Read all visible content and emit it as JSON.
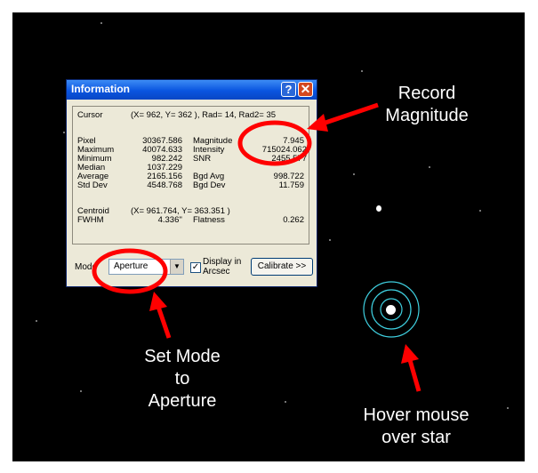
{
  "window": {
    "title": "Information",
    "help_glyph": "?",
    "close_glyph": "✕",
    "cursor_label": "Cursor",
    "cursor_value": "(X= 962, Y= 362 ), Rad= 14, Rad2= 35",
    "pixel_label": "Pixel",
    "pixel_value": "30367.586",
    "maximum_label": "Maximum",
    "maximum_value": "40074.633",
    "minimum_label": "Minimum",
    "minimum_value": "982.242",
    "median_label": "Median",
    "median_value": "1037.229",
    "average_label": "Average",
    "average_value": "2165.156",
    "stddev_label": "Std Dev",
    "stddev_value": "4548.768",
    "magnitude_label": "Magnitude",
    "magnitude_value": "7.945",
    "intensity_label": "Intensity",
    "intensity_value": "715024.062",
    "snr_label": "SNR",
    "snr_value": "2455.577",
    "bgdavg_label": "Bgd Avg",
    "bgdavg_value": "998.722",
    "bgddev_label": "Bgd Dev",
    "bgddev_value": "11.759",
    "centroid_label": "Centroid",
    "centroid_value": "(X= 961.764, Y= 363.351 )",
    "fwhm_label": "FWHM",
    "fwhm_value": "4.336''",
    "flatness_label": "Flatness",
    "flatness_value": "0.262",
    "mode_label": "Mode",
    "mode_value": "Aperture",
    "display_arcsec_checked": true,
    "display_arcsec_label_1": "Display in",
    "display_arcsec_label_2": "Arcsec",
    "calibrate_label": "Calibrate >>"
  },
  "annotations": {
    "record_line1": "Record",
    "record_line2": "Magnitude",
    "setmode_line1": "Set Mode",
    "setmode_line2": "to",
    "setmode_line3": "Aperture",
    "hover_line1": "Hover mouse",
    "hover_line2": "over star",
    "highlight_color": "#ff0000",
    "aperture_ring_color": "#3fd0e0"
  },
  "icons": {
    "checkbox": "checkmark-icon",
    "dropdown": "chevron-down-icon"
  }
}
